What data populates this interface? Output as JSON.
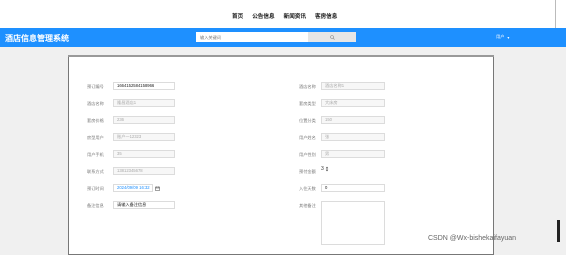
{
  "nav": {
    "links": [
      "首页",
      "公告信息",
      "新闻资讯",
      "客房信息"
    ]
  },
  "header": {
    "brand": "酒店信息管理系统",
    "search_placeholder": "输入关键词",
    "user": "用户",
    "user_arrow": "▾"
  },
  "form": {
    "left": [
      {
        "label": "预订编号",
        "value": "1664152584158966",
        "style": "dark"
      },
      {
        "label": "酒店名称",
        "value": "隆昌酒店1",
        "style": "light"
      },
      {
        "label": "套房价格",
        "value": "236",
        "style": "light"
      },
      {
        "label": "房型用户",
        "value": "账户一12323",
        "style": "light"
      },
      {
        "label": "用户手机",
        "value": "35",
        "style": "light"
      },
      {
        "label": "联系方式",
        "value": "13812345678",
        "style": "light"
      },
      {
        "label": "预订时间",
        "value": "2024/09/09 16:32",
        "style": "blue"
      },
      {
        "label": "备注信息",
        "value": "请输入备注信息",
        "style": "dark"
      }
    ],
    "right": [
      {
        "label": "酒店名称",
        "value": "酒店名称1",
        "style": "light"
      },
      {
        "label": "套房类型",
        "value": "大床房",
        "style": "light"
      },
      {
        "label": "位置分类",
        "value": "150",
        "style": "light"
      },
      {
        "label": "用户姓名",
        "value": "张",
        "style": "light"
      },
      {
        "label": "用户性别",
        "value": "男",
        "style": "light"
      },
      {
        "label": "预付金额",
        "value": "3",
        "style": "stepper"
      },
      {
        "label": "入住天数",
        "value": "0",
        "style": "dark"
      },
      {
        "label": "其他备注",
        "value": "",
        "style": "textarea"
      }
    ]
  },
  "watermark": "CSDN @Wx-bishekaifayuan"
}
